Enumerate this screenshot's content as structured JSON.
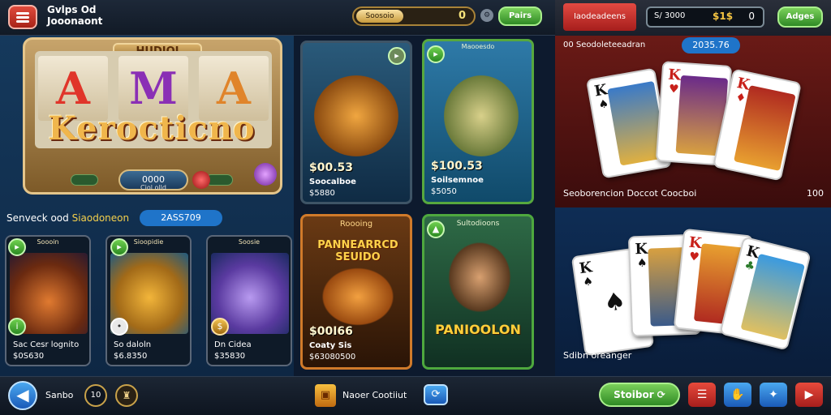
{
  "header": {
    "brand_line1": "Gvlps Od",
    "brand_line2": "Jooonaont",
    "coins_label": "Soosoio",
    "coins_value": "0",
    "coin_icon": "info-coin-icon",
    "play_button": "Pairs",
    "right_tab": "Iaodeadeens",
    "score_prefix": "S/ 3000",
    "score_amount": "$1$",
    "score_value": "0",
    "right_button": "Adges"
  },
  "slot": {
    "title": "HUDIOI",
    "reels": [
      "A",
      "M",
      "A"
    ],
    "logo": "Kerocticno",
    "button_value": "0000",
    "button_sub": "Ciol olld"
  },
  "section": {
    "label": "Senveck ood ",
    "label_highlight": "Siaodoneon",
    "pill": "2ASS709"
  },
  "small_cards": [
    {
      "title": "Soooin",
      "name": "Sac Cesr lognito",
      "price": "$0S630"
    },
    {
      "title": "Sioopidie",
      "name": "So daloln",
      "price": "$6.8350"
    },
    {
      "title": "Soosie",
      "name": "Dn Cidea",
      "price": "$35830"
    }
  ],
  "mid_cards": [
    {
      "big": "$00.53",
      "name": "Soocalboe",
      "price": "$5880"
    },
    {
      "title": "Maooesdo",
      "big": "$100.53",
      "name": "Soilsemnoe",
      "price": "$5050"
    },
    {
      "title": "Roooing",
      "banner": "PANNEARRCD SEUIDO",
      "big": "$00I66",
      "name": "Coaty Sis",
      "price": "$63080500"
    },
    {
      "title": "Sultodioons",
      "banner": "PANIOOLON"
    }
  ],
  "cards_panel": {
    "top_label": "00 Seodoleteeadran",
    "top_pill": "2035.76",
    "top_caption": "Seoborencion Doccot  Coocboi",
    "top_badge": "100",
    "bottom_caption": "Sdibn oreanger"
  },
  "footer": {
    "back_icon": "back-arrow-icon",
    "label": "Sanbo",
    "round_value": "10",
    "mid_label": "Naoer Cootiiut",
    "start_button": "Stoibor"
  },
  "colors": {
    "accent_green": "#2f8a25",
    "accent_red": "#a61e1c",
    "accent_blue": "#1f74c9",
    "gold": "#f6e27a"
  }
}
